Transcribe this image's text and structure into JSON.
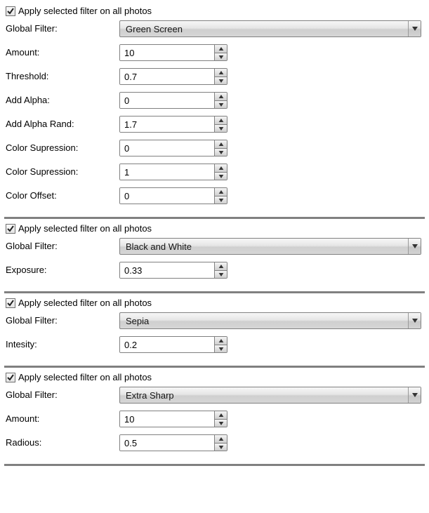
{
  "apply_label": "Apply selected filter on all photos",
  "global_filter_label": "Global Filter:",
  "panels": [
    {
      "checked": true,
      "filter_value": "Green Screen",
      "params": [
        {
          "label": "Amount:",
          "value": "10"
        },
        {
          "label": "Threshold:",
          "value": "0.7"
        },
        {
          "label": "Add Alpha:",
          "value": "0"
        },
        {
          "label": "Add Alpha Rand:",
          "value": "1.7"
        },
        {
          "label": "Color Supression:",
          "value": "0"
        },
        {
          "label": "Color Supression:",
          "value": "1"
        },
        {
          "label": "Color Offset:",
          "value": "0"
        }
      ]
    },
    {
      "checked": true,
      "filter_value": "Black and White",
      "params": [
        {
          "label": "Exposure:",
          "value": "0.33"
        }
      ]
    },
    {
      "checked": true,
      "filter_value": "Sepia",
      "params": [
        {
          "label": "Intesity:",
          "value": "0.2"
        }
      ]
    },
    {
      "checked": true,
      "filter_value": "Extra Sharp",
      "params": [
        {
          "label": "Amount:",
          "value": "10"
        },
        {
          "label": "Radious:",
          "value": "0.5"
        }
      ]
    }
  ]
}
